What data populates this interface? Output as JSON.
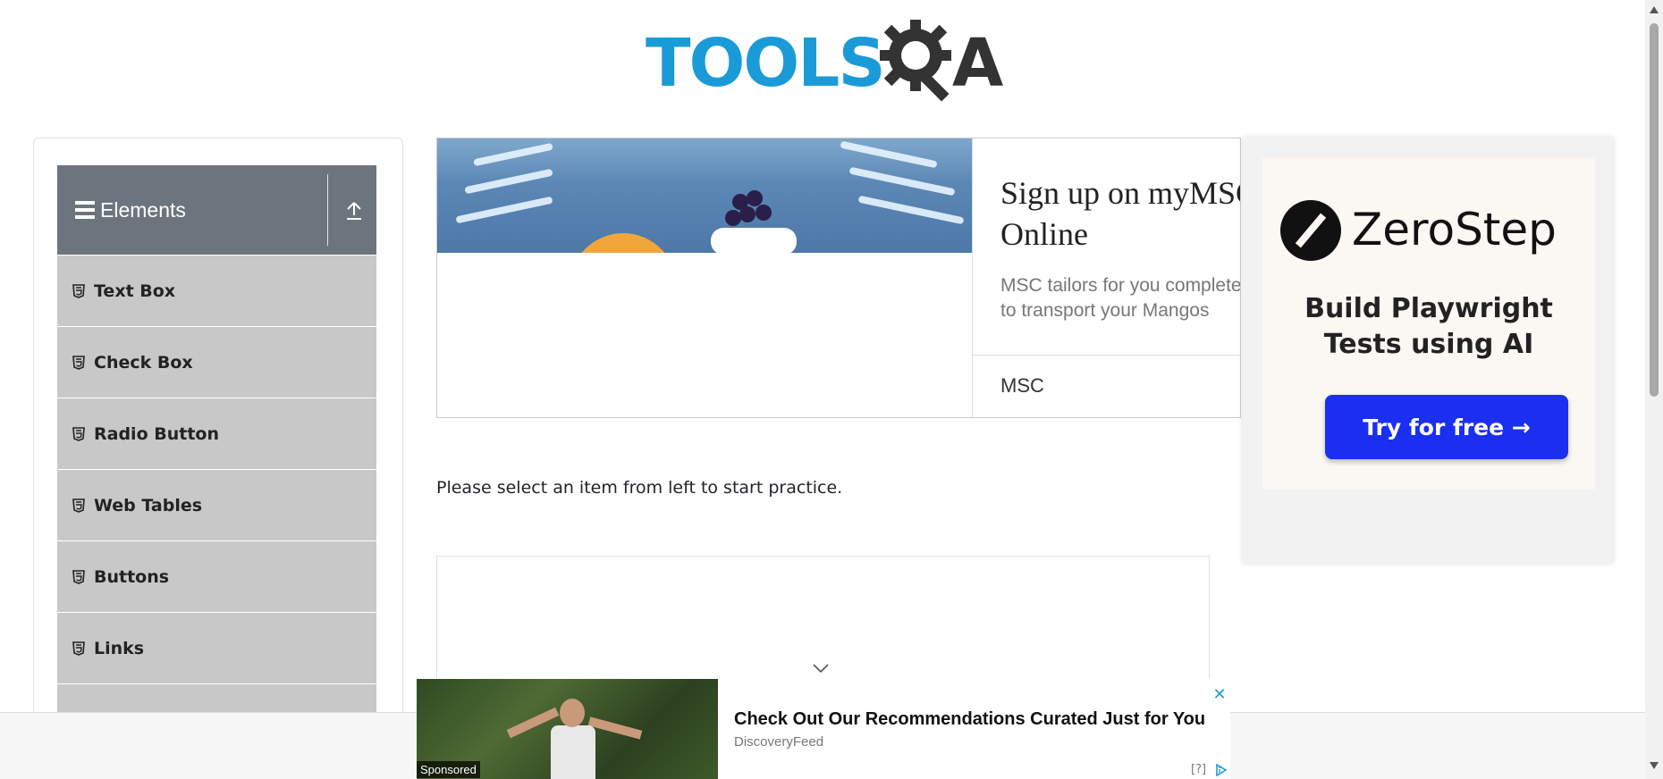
{
  "header": {
    "logo_text": "TOOLS",
    "logo_suffix": "A",
    "logo_alt": "TOOLSQA"
  },
  "sidebar": {
    "group_title": "Elements",
    "items": [
      {
        "label": "Text Box"
      },
      {
        "label": "Check Box"
      },
      {
        "label": "Radio Button"
      },
      {
        "label": "Web Tables"
      },
      {
        "label": "Buttons"
      },
      {
        "label": "Links"
      },
      {
        "label": ""
      }
    ]
  },
  "top_ad": {
    "headline": "Sign up on myMSC Online",
    "body": "MSC tailors for you complete\nto transport your Mangos",
    "brand": "MSC"
  },
  "right_ad": {
    "brand": "ZeroStep",
    "tagline": "Build Playwright Tests using AI",
    "cta": "Try for free →"
  },
  "main": {
    "instruction": "Please select an item from left to start practice."
  },
  "bottom_ad": {
    "sponsored": "Sponsored",
    "title": "Check Out Our Recommendations Curated Just for You",
    "source": "DiscoveryFeed",
    "adchoice": "[?]"
  },
  "colors": {
    "logo_blue": "#1a9bd7",
    "header_gray": "#6c757d",
    "menu_gray": "#c8c8c8",
    "cta_blue": "#1a2ff0"
  }
}
